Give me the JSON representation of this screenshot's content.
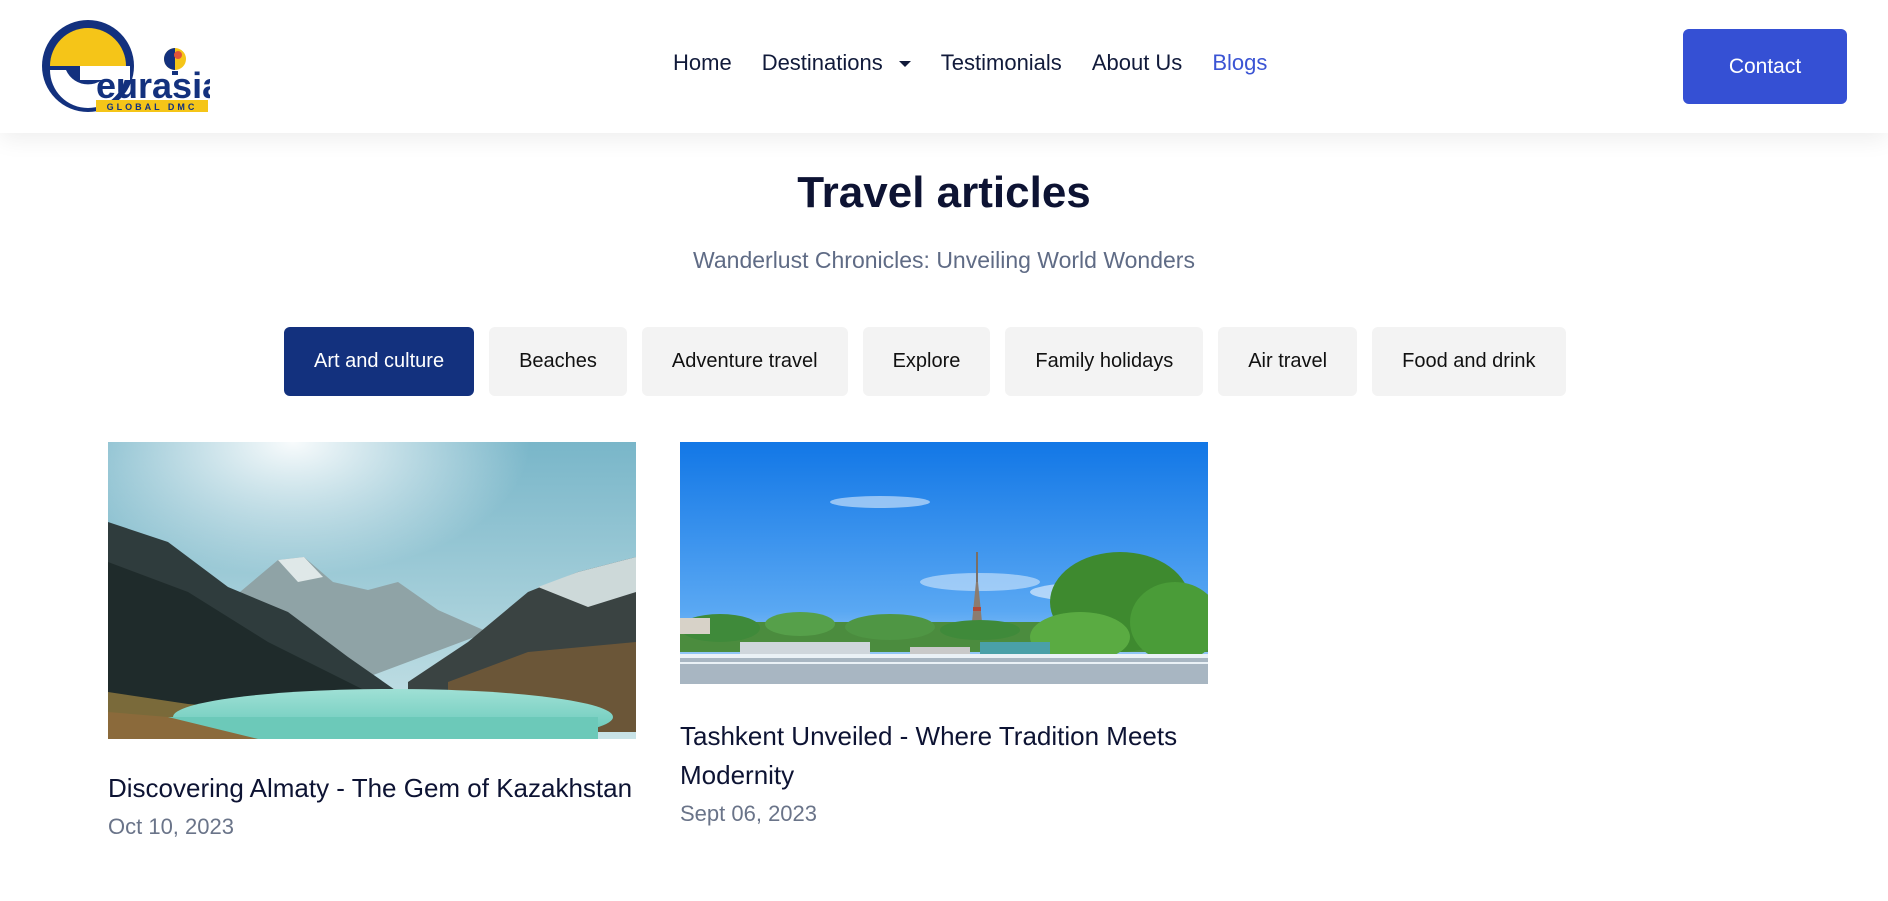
{
  "brand": {
    "logo_word": "eurasia",
    "logo_tagline": "GLOBAL DMC",
    "colors": {
      "navy": "#13317e",
      "yellow": "#f5c518",
      "accent_blue": "#3550d4"
    }
  },
  "nav": {
    "items": [
      {
        "label": "Home"
      },
      {
        "label": "Destinations",
        "icon": "chevron-down-icon"
      },
      {
        "label": "Testimonials"
      },
      {
        "label": "About Us"
      },
      {
        "label": "Blogs",
        "active": true
      }
    ],
    "contact_label": "Contact"
  },
  "hero": {
    "title": "Travel articles",
    "subtitle": "Wanderlust Chronicles: Unveiling World Wonders"
  },
  "filters": {
    "chips": [
      {
        "label": "Art and culture",
        "active": true
      },
      {
        "label": "Beaches"
      },
      {
        "label": "Adventure travel"
      },
      {
        "label": "Explore"
      },
      {
        "label": "Family holidays"
      },
      {
        "label": "Air travel"
      },
      {
        "label": "Food and drink"
      }
    ]
  },
  "articles": [
    {
      "title": "Discovering Almaty - The Gem of Kazakhstan",
      "date": "Oct 10, 2023",
      "image": "mountain-lake-photo"
    },
    {
      "title": "Tashkent Unveiled - Where Tradition Meets Modernity",
      "date": "Sept 06, 2023",
      "image": "city-skyline-photo"
    }
  ]
}
